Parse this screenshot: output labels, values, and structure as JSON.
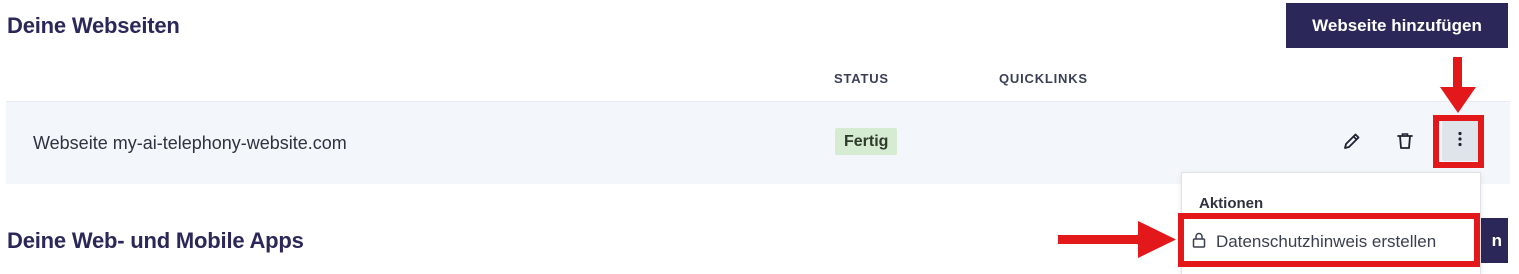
{
  "websites_section": {
    "title": "Deine Webseiten",
    "add_button": "Webseite hinzufügen",
    "columns": {
      "status": "STATUS",
      "quicklinks": "QUICKLINKS"
    },
    "rows": [
      {
        "name": "Webseite my-ai-telephony-website.com",
        "status": "Fertig",
        "actions": [
          "edit-icon",
          "trash-icon",
          "more-vertical-icon"
        ]
      }
    ]
  },
  "dropdown": {
    "heading": "Aktionen",
    "items": [
      {
        "label": "Datenschutzhinweis erstellen",
        "icon": "lock-icon"
      }
    ]
  },
  "apps_section": {
    "title": "Deine Web- und Mobile Apps",
    "add_button_visible_text": "n"
  },
  "colors": {
    "primary": "#2b2859",
    "status_badge_bg": "#d6ecd2",
    "annotation_red": "#e3181b",
    "row_bg": "#f3f6fa"
  }
}
